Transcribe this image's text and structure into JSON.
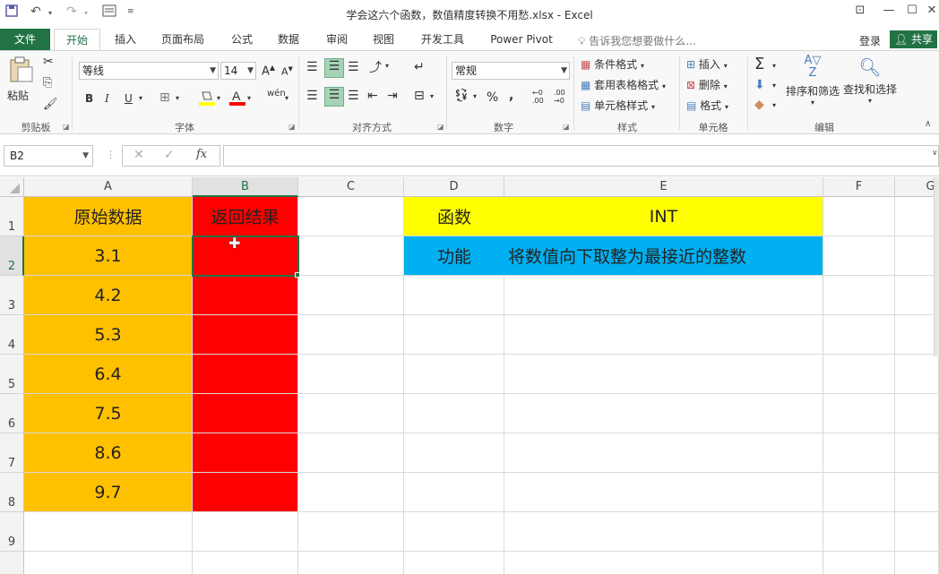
{
  "window": {
    "title": "学会这六个函数，数值精度转换不用愁.xlsx - Excel"
  },
  "tabs": [
    "文件",
    "开始",
    "插入",
    "页面布局",
    "公式",
    "数据",
    "审阅",
    "视图",
    "开发工具",
    "Power Pivot"
  ],
  "tell_me": "告诉我您想要做什么...",
  "sign_in": "登录",
  "share": "共享",
  "ribbon": {
    "clipboard": {
      "paste": "粘贴",
      "label": "剪贴板"
    },
    "font": {
      "name": "等线",
      "size": "14",
      "label": "字体",
      "bold": "B",
      "italic": "I",
      "underline": "U",
      "phonetic": "wén"
    },
    "alignment": {
      "label": "对齐方式"
    },
    "number": {
      "format": "常规",
      "label": "数字"
    },
    "styles": {
      "conditional": "条件格式",
      "table": "套用表格格式",
      "cell_styles": "单元格样式",
      "label": "样式"
    },
    "cells": {
      "insert": "插入",
      "delete": "删除",
      "format": "格式",
      "label": "单元格"
    },
    "editing": {
      "sort_filter": "排序和筛选",
      "find_select": "查找和选择",
      "label": "编辑"
    }
  },
  "formula_bar": {
    "name_box": "B2",
    "cancel": "✕",
    "enter": "✓",
    "fx": "fx",
    "value": ""
  },
  "sheet": {
    "columns": [
      "A",
      "B",
      "C",
      "D",
      "E",
      "F",
      "G"
    ],
    "rows": [
      "1",
      "2",
      "3",
      "4",
      "5",
      "6",
      "7",
      "8",
      "9"
    ],
    "selected_cell": "B2",
    "colors": {
      "orange": "#ffc000",
      "red": "#ff0000",
      "yellow": "#ffff00",
      "blue": "#00b0f0",
      "accent": "#217346"
    },
    "A": [
      "原始数据",
      "3.1",
      "4.2",
      "5.3",
      "6.4",
      "7.5",
      "8.6",
      "9.7"
    ],
    "B1": "返回结果",
    "D1": "函数",
    "E1": "INT",
    "D2": "功能",
    "E2": "将数值向下取整为最接近的整数"
  }
}
